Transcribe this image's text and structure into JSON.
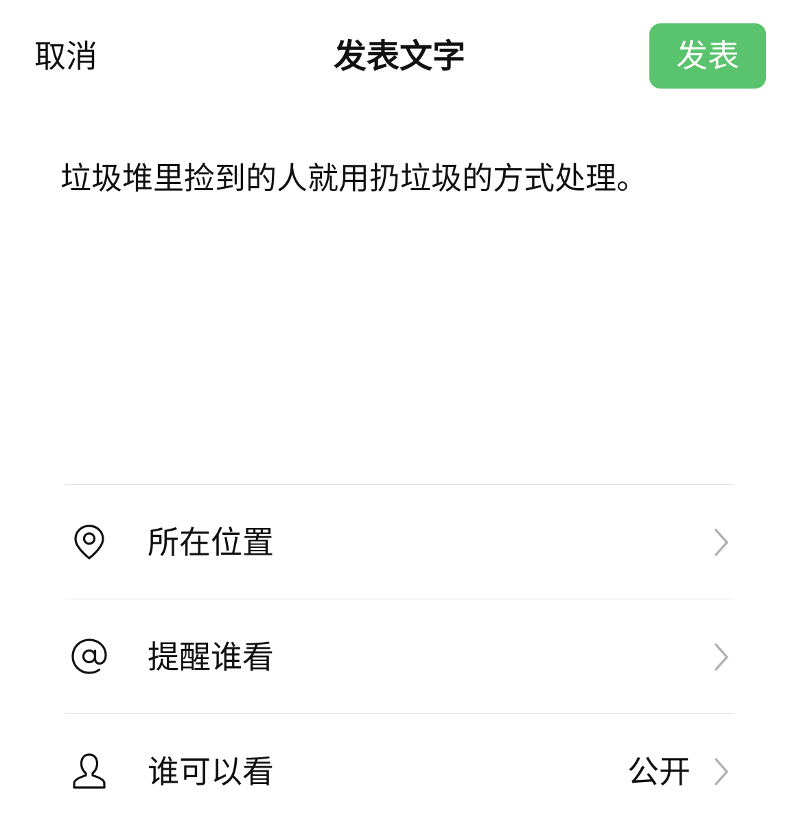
{
  "header": {
    "cancel_label": "取消",
    "title": "发表文字",
    "publish_label": "发表"
  },
  "post": {
    "text": "垃圾堆里捡到的人就用扔垃圾的方式处理。"
  },
  "options": [
    {
      "label": "所在位置",
      "icon": "location-pin-icon",
      "value": ""
    },
    {
      "label": "提醒谁看",
      "icon": "at-sign-icon",
      "value": ""
    },
    {
      "label": "谁可以看",
      "icon": "person-icon",
      "value": "公开"
    }
  ],
  "colors": {
    "publish_button": "#5ac36d",
    "divider": "#e2e2e2",
    "chevron": "#b2b2b2",
    "text": "#111111"
  }
}
